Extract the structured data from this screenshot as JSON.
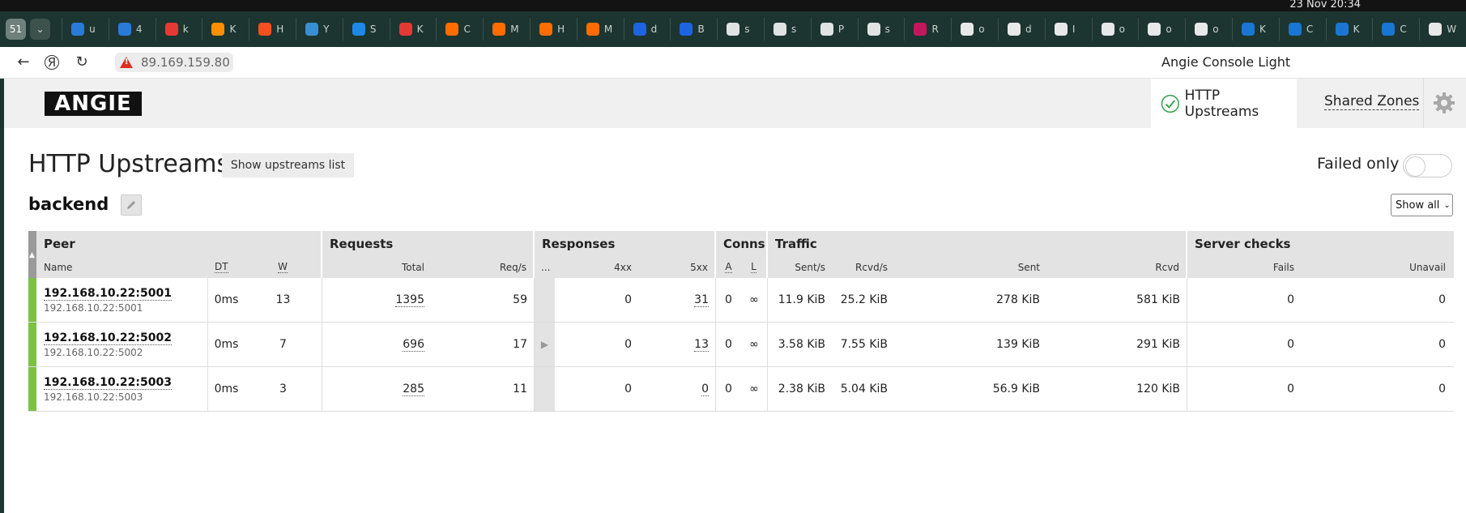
{
  "system": {
    "clock": "23 Nov  20:34"
  },
  "browser": {
    "tab_count": "51",
    "tabs": [
      {
        "fav": "#2a7bd8",
        "t": "u"
      },
      {
        "fav": "#2a7bd8",
        "t": "4"
      },
      {
        "fav": "#e53935",
        "t": "k"
      },
      {
        "fav": "#ff8f00",
        "t": "K"
      },
      {
        "fav": "#f4511e",
        "t": "H"
      },
      {
        "fav": "#3a8fd0",
        "t": "Y"
      },
      {
        "fav": "#1e88e5",
        "t": "S"
      },
      {
        "fav": "#e53935",
        "t": "K"
      },
      {
        "fav": "#ff6d00",
        "t": "C"
      },
      {
        "fav": "#ff6d00",
        "t": "M"
      },
      {
        "fav": "#ff6d00",
        "t": "H"
      },
      {
        "fav": "#ff6d00",
        "t": "M"
      },
      {
        "fav": "#1e63e0",
        "t": "d"
      },
      {
        "fav": "#1e63e0",
        "t": "B"
      },
      {
        "fav": "#dfe4e2",
        "t": "s"
      },
      {
        "fav": "#dfe4e2",
        "t": "s"
      },
      {
        "fav": "#dfe4e2",
        "t": "P"
      },
      {
        "fav": "#dfe4e2",
        "t": "s"
      },
      {
        "fav": "#c2185b",
        "t": "R"
      },
      {
        "fav": "#e8e8e8",
        "t": "o"
      },
      {
        "fav": "#e8e8e8",
        "t": "d"
      },
      {
        "fav": "#e8e8e8",
        "t": "I"
      },
      {
        "fav": "#e8e8e8",
        "t": "o"
      },
      {
        "fav": "#e8e8e8",
        "t": "o"
      },
      {
        "fav": "#e8e8e8",
        "t": "o"
      },
      {
        "fav": "#1976d2",
        "t": "K"
      },
      {
        "fav": "#1976d2",
        "t": "C"
      },
      {
        "fav": "#1976d2",
        "t": "K"
      },
      {
        "fav": "#1976d2",
        "t": "C"
      },
      {
        "fav": "#e8e8e8",
        "t": "W"
      }
    ],
    "url": "89.169.159.80",
    "page_title": "Angie Console Light"
  },
  "app": {
    "logo": "ANGIE",
    "nav": {
      "http_upstreams": "HTTP Upstreams",
      "shared_zones": "Shared Zones"
    },
    "page_heading": "HTTP Upstreams",
    "show_list_button": "Show upstreams list",
    "failed_only": "Failed only",
    "upstream_name": "backend",
    "show_filter": "Show all"
  },
  "table": {
    "groups": {
      "peer": "Peer",
      "requests": "Requests",
      "responses": "Responses",
      "conns": "Conns",
      "traffic": "Traffic",
      "server_checks": "Server checks"
    },
    "columns": {
      "name": "Name",
      "dt": "DT",
      "w": "W",
      "total": "Total",
      "req_s": "Req/s",
      "more": "...",
      "r4xx": "4xx",
      "r5xx": "5xx",
      "a": "A",
      "l": "L",
      "sent_s": "Sent/s",
      "rcvd_s": "Rcvd/s",
      "sent": "Sent",
      "rcvd": "Rcvd",
      "fails": "Fails",
      "unavail": "Unavail"
    },
    "rows": [
      {
        "name": "192.168.10.22:5001",
        "addr": "192.168.10.22:5001",
        "dt": "0ms",
        "w": "13",
        "total": "1395",
        "req_s": "59",
        "more": "",
        "r4xx": "0",
        "r5xx": "31",
        "a": "0",
        "l": "∞",
        "sent_s": "11.9 KiB",
        "rcvd_s": "25.2 KiB",
        "sent": "278 KiB",
        "rcvd": "581 KiB",
        "fails": "0",
        "unavail": "0"
      },
      {
        "name": "192.168.10.22:5002",
        "addr": "192.168.10.22:5002",
        "dt": "0ms",
        "w": "7",
        "total": "696",
        "req_s": "17",
        "more": "▶",
        "r4xx": "0",
        "r5xx": "13",
        "a": "0",
        "l": "∞",
        "sent_s": "3.58 KiB",
        "rcvd_s": "7.55 KiB",
        "sent": "139 KiB",
        "rcvd": "291 KiB",
        "fails": "0",
        "unavail": "0"
      },
      {
        "name": "192.168.10.22:5003",
        "addr": "192.168.10.22:5003",
        "dt": "0ms",
        "w": "3",
        "total": "285",
        "req_s": "11",
        "more": "",
        "r4xx": "0",
        "r5xx": "0",
        "a": "0",
        "l": "∞",
        "sent_s": "2.38 KiB",
        "rcvd_s": "5.04 KiB",
        "sent": "56.9 KiB",
        "rcvd": "120 KiB",
        "fails": "0",
        "unavail": "0"
      }
    ]
  },
  "colors": {
    "status_up": "#7cc146",
    "header_bg": "#e3e3e3",
    "check_green": "#3aa655"
  }
}
